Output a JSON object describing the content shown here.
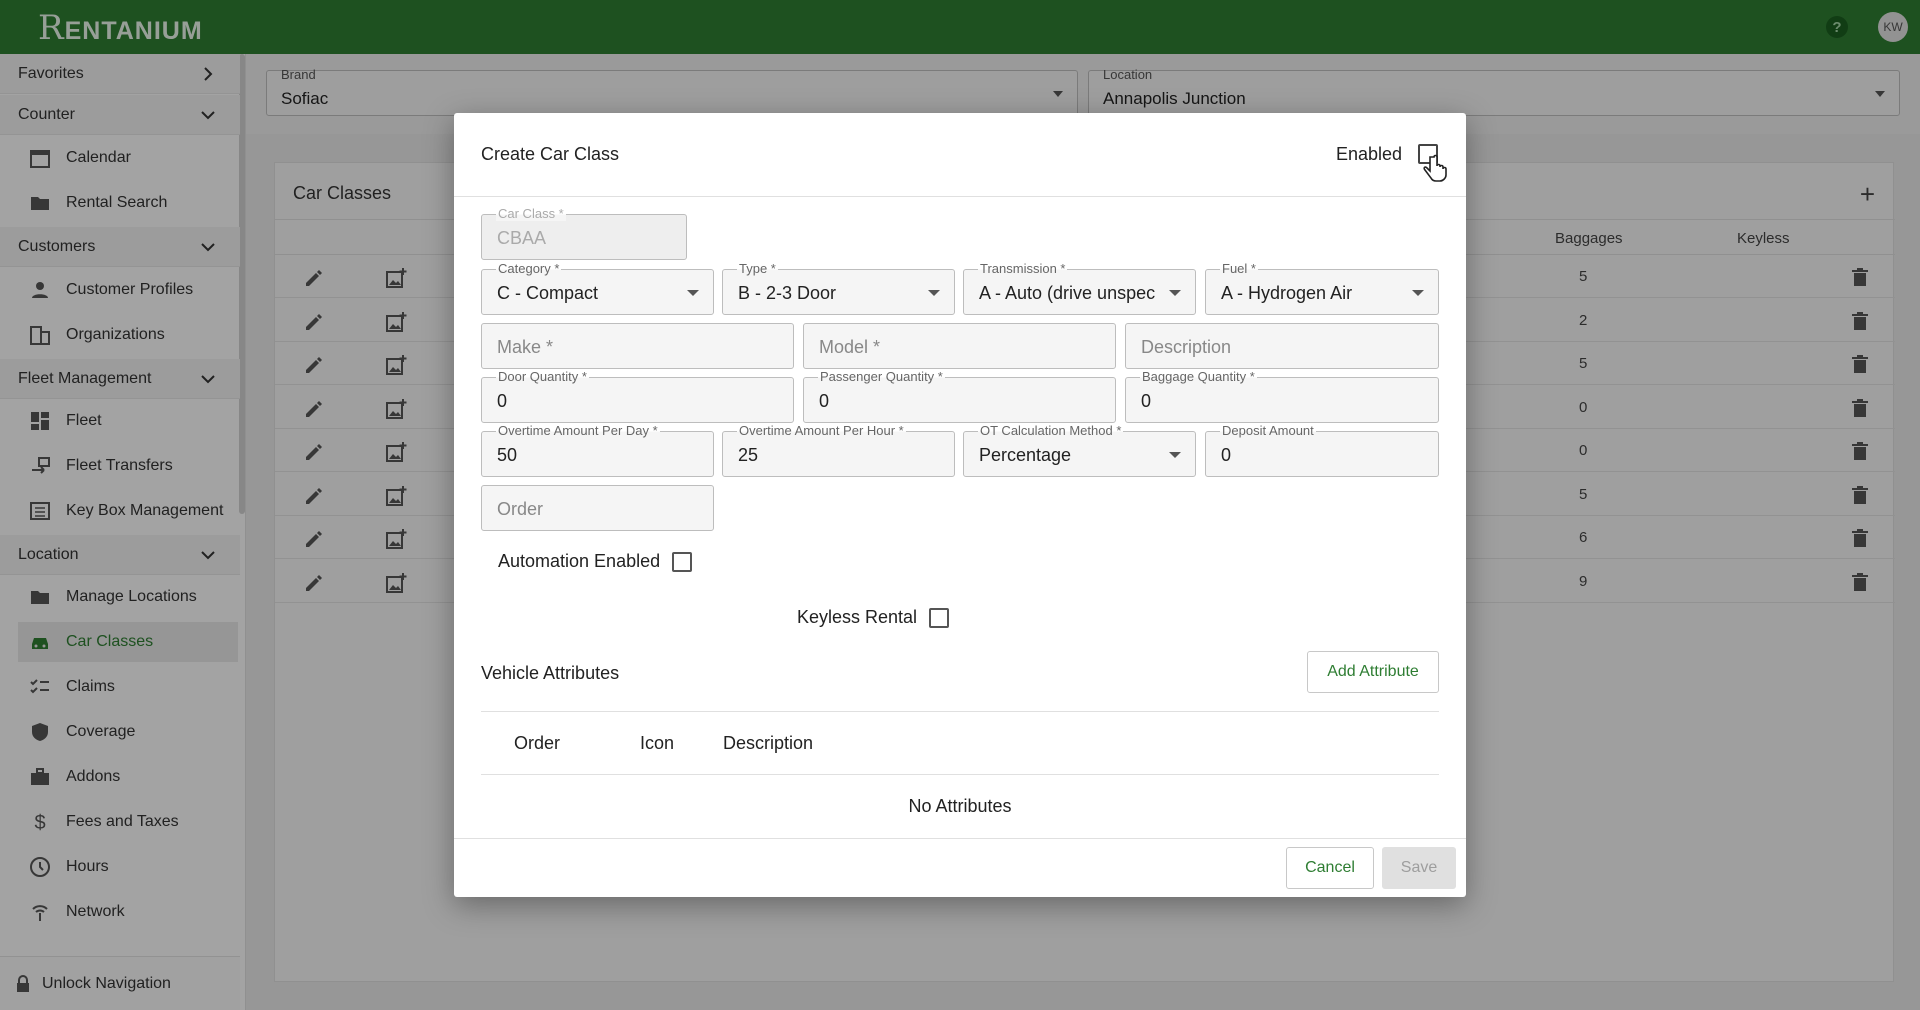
{
  "app": {
    "logo_initial": "R",
    "logo_rest": "ENTANIUM",
    "user_initials": "KW"
  },
  "sidebar": {
    "favorites": "Favorites",
    "counter": "Counter",
    "calendar": "Calendar",
    "rental_search": "Rental Search",
    "customers": "Customers",
    "customer_profiles": "Customer Profiles",
    "organizations": "Organizations",
    "fleet_management": "Fleet Management",
    "fleet": "Fleet",
    "fleet_transfers": "Fleet Transfers",
    "key_box_management": "Key Box Management",
    "location": "Location",
    "manage_locations": "Manage Locations",
    "car_classes": "Car Classes",
    "claims": "Claims",
    "coverage": "Coverage",
    "addons": "Addons",
    "fees_and_taxes": "Fees and Taxes",
    "hours": "Hours",
    "network": "Network",
    "unlock_navigation": "Unlock Navigation"
  },
  "filters": {
    "brand_label": "Brand",
    "brand_value": "Sofiac",
    "location_label": "Location",
    "location_value": "Annapolis Junction"
  },
  "table": {
    "title": "Car Classes",
    "col_baggages": "Baggages",
    "col_keyless": "Keyless",
    "rows": [
      {
        "baggages": "5"
      },
      {
        "baggages": "2"
      },
      {
        "baggages": "5"
      },
      {
        "baggages": "0"
      },
      {
        "baggages": "0"
      },
      {
        "baggages": "5"
      },
      {
        "baggages": "6"
      },
      {
        "baggages": "9"
      }
    ]
  },
  "dialog": {
    "title": "Create Car Class",
    "enabled_label": "Enabled",
    "car_class": {
      "label": "Car Class *",
      "value": "CBAA"
    },
    "category": {
      "label": "Category *",
      "value": "C - Compact"
    },
    "type": {
      "label": "Type *",
      "value": "B - 2-3 Door"
    },
    "transmission": {
      "label": "Transmission *",
      "value": "A - Auto (drive unspec"
    },
    "fuel": {
      "label": "Fuel *",
      "value": "A - Hydrogen Air"
    },
    "make": {
      "placeholder": "Make *"
    },
    "model": {
      "placeholder": "Model *"
    },
    "description": {
      "placeholder": "Description"
    },
    "door_quantity": {
      "label": "Door Quantity *",
      "value": "0"
    },
    "passenger_quantity": {
      "label": "Passenger Quantity *",
      "value": "0"
    },
    "baggage_quantity": {
      "label": "Baggage Quantity *",
      "value": "0"
    },
    "ot_per_day": {
      "label": "Overtime Amount Per Day *",
      "value": "50"
    },
    "ot_per_hour": {
      "label": "Overtime Amount Per Hour *",
      "value": "25"
    },
    "ot_method": {
      "label": "OT Calculation Method *",
      "value": "Percentage"
    },
    "deposit": {
      "label": "Deposit Amount",
      "value": "0"
    },
    "order": {
      "placeholder": "Order"
    },
    "automation_enabled": "Automation Enabled",
    "keyless_rental": "Keyless Rental",
    "vehicle_attributes": "Vehicle Attributes",
    "add_attribute": "Add Attribute",
    "attr_col_order": "Order",
    "attr_col_icon": "Icon",
    "attr_col_description": "Description",
    "no_attributes": "No Attributes",
    "cancel": "Cancel",
    "save": "Save"
  },
  "colors": {
    "brand_green": "#2e7d32",
    "overlay": "rgba(0,0,0,0.35)"
  }
}
